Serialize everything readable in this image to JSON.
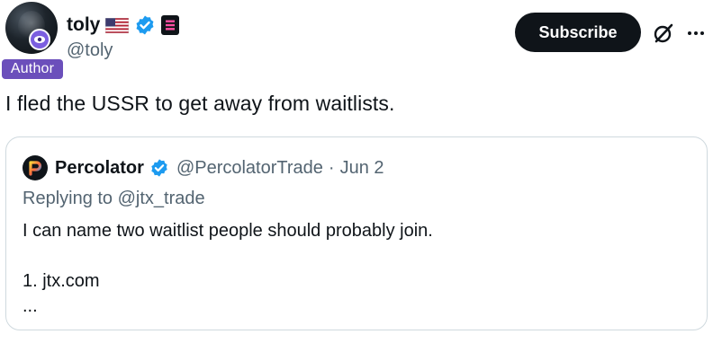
{
  "author": {
    "display_name": "toly",
    "handle": "@toly",
    "author_tag": "Author"
  },
  "actions": {
    "subscribe_label": "Subscribe"
  },
  "tweet": {
    "text": "I fled the USSR to get away from waitlists."
  },
  "quote": {
    "display_name": "Percolator",
    "handle": "@PercolatorTrade",
    "separator": "·",
    "date": "Jun 2",
    "replying_prefix": "Replying to ",
    "replying_mention": "@jtx_trade",
    "lines": [
      "I can name two waitlist people should probably join.",
      "",
      "1. jtx.com",
      "..."
    ]
  },
  "icons": {
    "flag": "us-flag-icon",
    "verified": "verified-badge-icon",
    "affiliate": "solana-badge-icon",
    "grok": "grok-icon",
    "more": "more-icon"
  },
  "colors": {
    "text_primary": "#0f1419",
    "text_secondary": "#536471",
    "verified_blue": "#1d9bf0",
    "author_tag_bg": "#6b4fbb",
    "border": "#cfd9de"
  }
}
